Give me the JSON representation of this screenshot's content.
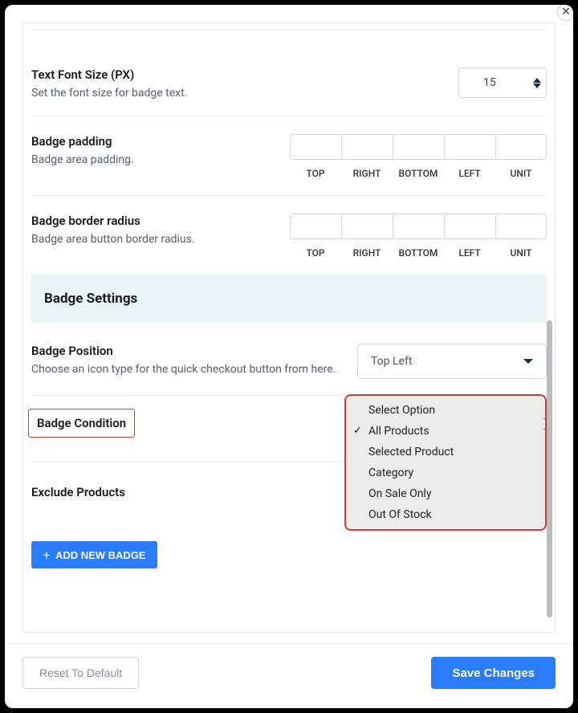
{
  "closeIcon": "✕",
  "fontSize": {
    "title": "Text Font Size (PX)",
    "desc": "Set the font size for badge text.",
    "value": "15"
  },
  "padding": {
    "title": "Badge padding",
    "desc": "Badge area padding.",
    "labels": [
      "TOP",
      "RIGHT",
      "BOTTOM",
      "LEFT",
      "UNIT"
    ]
  },
  "borderRadius": {
    "title": "Badge border radius",
    "desc": "Badge area button border radius.",
    "labels": [
      "TOP",
      "RIGHT",
      "BOTTOM",
      "LEFT",
      "UNIT"
    ]
  },
  "sectionTitle": "Badge Settings",
  "position": {
    "title": "Badge Position",
    "desc": "Choose an icon type for the quick checkout button from here.",
    "value": "Top Left"
  },
  "condition": {
    "title": "Badge Condition",
    "options": [
      "Select Option",
      "All Products",
      "Selected Product",
      "Category",
      "On Sale Only",
      "Out Of Stock"
    ],
    "selectedIndex": 1
  },
  "exclude": {
    "title": "Exclude Products"
  },
  "addBadgeLabel": "ADD NEW BADGE",
  "footer": {
    "reset": "Reset To Default",
    "save": "Save Changes"
  }
}
